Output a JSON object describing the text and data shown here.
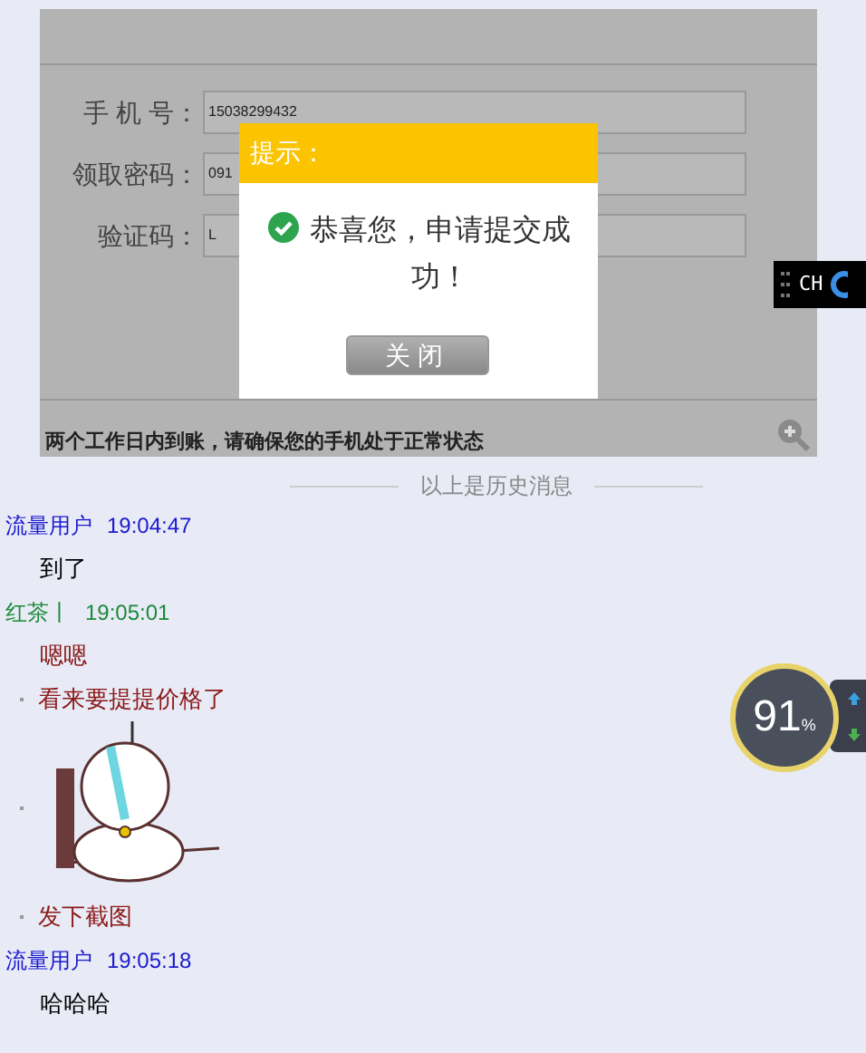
{
  "screenshot": {
    "fields": [
      {
        "label": "手 机 号：",
        "value": "15038299432"
      },
      {
        "label": "领取密码：",
        "value": "091"
      },
      {
        "label": "验证码：",
        "value": "L"
      }
    ],
    "notice": "两个工作日内到账，请确保您的手机处于正常状态",
    "dialog": {
      "title": "提示：",
      "message": "恭喜您，申请提交成功！",
      "button": "关闭"
    }
  },
  "ime_indicator": "CH",
  "history_divider": "以上是历史消息",
  "messages": [
    {
      "kind": "self",
      "sender": "流量用户",
      "time": "19:04:47",
      "parts": [
        {
          "kind": "text",
          "text": "到了"
        }
      ]
    },
    {
      "kind": "other",
      "sender": "红茶丨",
      "time": "19:05:01",
      "parts": [
        {
          "kind": "text",
          "text": "嗯嗯"
        }
      ]
    },
    {
      "kind": "other",
      "bulleted": true,
      "parts": [
        {
          "kind": "text",
          "text": "看来要提提价格了"
        },
        {
          "kind": "sticker"
        },
        {
          "kind": "text",
          "text": "发下截图"
        }
      ]
    },
    {
      "kind": "self",
      "sender": "流量用户",
      "time": "19:05:18",
      "parts": [
        {
          "kind": "text",
          "text": "哈哈哈"
        }
      ]
    }
  ],
  "speed_widget": {
    "percent": "91",
    "unit": "%"
  }
}
